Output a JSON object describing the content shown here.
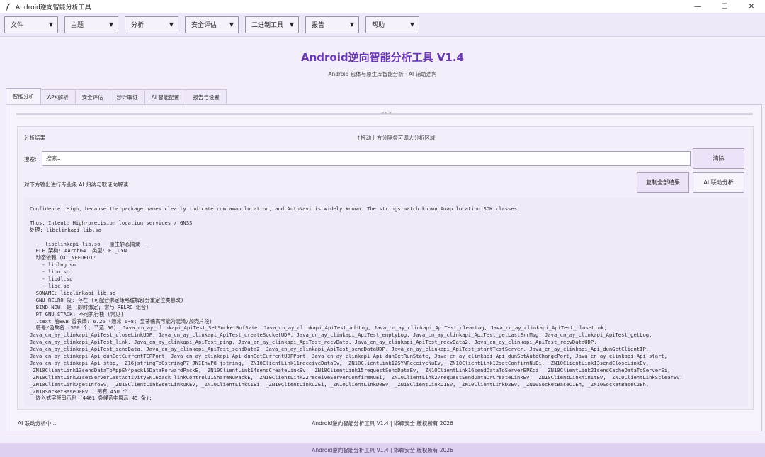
{
  "window": {
    "title": "Android逆向智能分析工具",
    "icon": "feather-icon",
    "controls": {
      "minimize": "—",
      "maximize": "☐",
      "close": "✕"
    }
  },
  "toolbar": {
    "menus": [
      {
        "label": "文件"
      },
      {
        "label": "主题"
      },
      {
        "label": "分析"
      },
      {
        "label": "安全评估"
      },
      {
        "label": "二进制工具"
      },
      {
        "label": "报告"
      },
      {
        "label": "帮助"
      }
    ],
    "caret": "▼"
  },
  "header": {
    "title": "Android逆向智能分析工具 V1.4",
    "subtitle": "Android 包体与原生库智能分析 · AI 辅助逆向"
  },
  "tabs": [
    {
      "label": "智能分析",
      "active": true
    },
    {
      "label": "APK解析"
    },
    {
      "label": "安全评估"
    },
    {
      "label": "涉诈取证"
    },
    {
      "label": "AI 智能配置"
    },
    {
      "label": "报告与设置"
    }
  ],
  "panel": {
    "splitter_grip": "⠿⠿⠿",
    "result_label": "分析结果",
    "drag_hint": "↑拖动上方分隔条可调大分析区域",
    "search": {
      "label": "搜索:",
      "placeholder": "搜索..."
    },
    "clear_button": "清除",
    "ai_hint": "对下方输出进行专业级 AI 归纳与取证向解读",
    "copy_button": "复制全部结果",
    "ai_button": "AI 联动分析",
    "output_lines": [
      "Confidence: High, because the package names clearly indicate com.amap.location, and AutoNavi is widely known. The strings match known Amap location SDK classes.",
      "",
      "Thus, Intent: High-precision location services / GNSS",
      "处理: libclinkapi-lib.so",
      "",
      "  ── libclinkapi-lib.so · 原生静态摘录 ──",
      "  ELF 架构: AArch64  类型: ET_DYN",
      "  动态依赖 (DT_NEEDED):",
      "    - liblog.so",
      "    - libm.so",
      "    - libdl.so",
      "    - libc.so",
      "  SONAME: libclinkapi-lib.so",
      "  GNU RELRO 段: 存在 (可配合绑定策略缓解部分重定位类篡改)",
      "  BIND_NOW: 是 (即时绑定; 常与 RELRO 组合)",
      "  PT_GNU_STACK: 不可执行栈 (常见)",
      "  .text 前8KB 香农熵: 6.26 (通常 6~8; 显著偏高可能为混淆/加壳片段)",
      "  符号/函数名 (500 个, 节选 50): Java_cn_ay_clinkapi_ApiTest_SetSocketBufSzie, Java_cn_ay_clinkapi_ApiTest_addLog, Java_cn_ay_clinkapi_ApiTest_clearLog, Java_cn_ay_clinkapi_ApiTest_closeLink,",
      "Java_cn_ay_clinkapi_ApiTest_closeLinkUDP, Java_cn_ay_clinkapi_ApiTest_createSocketUDP, Java_cn_ay_clinkapi_ApiTest_emptyLog, Java_cn_ay_clinkapi_ApiTest_getLastErrMsg, Java_cn_ay_clinkapi_ApiTest_getLog,",
      "Java_cn_ay_clinkapi_ApiTest_link, Java_cn_ay_clinkapi_ApiTest_ping, Java_cn_ay_clinkapi_ApiTest_recvData, Java_cn_ay_clinkapi_ApiTest_recvData2, Java_cn_ay_clinkapi_ApiTest_recvDataUDP,",
      "Java_cn_ay_clinkapi_ApiTest_sendData, Java_cn_ay_clinkapi_ApiTest_sendData2, Java_cn_ay_clinkapi_ApiTest_sendDataUDP, Java_cn_ay_clinkapi_ApiTest_startTestServer, Java_cn_ay_clinkapi_Api_dunGetClientIP,",
      "Java_cn_ay_clinkapi_Api_dunGetCurrentTCPPort, Java_cn_ay_clinkapi_Api_dunGetCurrentUDPPort, Java_cn_ay_clinkapi_Api_dunGetRunState, Java_cn_ay_clinkapi_Api_dunSetAutoChangePort, Java_cn_ay_clinkapi_Api_start,",
      "Java_cn_ay_clinkapi_Api_stop, _Z16jstringToCstringP7_JNIEnvP8_jstring, _ZN10ClientLink11receiveDataEv, _ZN10ClientLink12SYNReceiveNuEv, _ZN10ClientLink12setConfirmNuEi, _ZN10ClientLink13sendCloseLinkEv,",
      "_ZN10ClientLink13sendDataToAppEN4pack15DataForwardPackE, _ZN10ClientLink14sendCreateLinkEv, _ZN10ClientLink15requestSendDataEv, _ZN10ClientLink16sendDataToServerEPKci, _ZN10ClientLink21sendCacheDataToServerEi,",
      "_ZN10ClientLink21setServerLastActivityEN16pack_linkControl11ShareNuPackE, _ZN10ClientLink22receiveServerConfirmNuEi, _ZN10ClientLink27requestSendDataOrCreateLinkEv, _ZN10ClientLink4inItEv, _ZN10ClientLinkSclearEv,",
      "_ZN10ClientLink7getInfoEv, _ZN10ClientLink9setLinkOKEv, _ZN10ClientLinkC1Ei, _ZN10ClientLinkC2Ei, _ZN10ClientLinkD0Ev, _ZN10ClientLinkD1Ev, _ZN10ClientLinkD2Ev, _ZN10SocketBaseC1Eh, _ZN10SocketBaseC2Eh,",
      "_ZN10SocketBaseD0Ev … 另有 450 个",
      "  嵌入式字符串示例 (4401 条候选中展示 45 条):"
    ]
  },
  "status": {
    "left": "AI 联动分析中...",
    "center": "Android逆向智能分析工具 V1.4 | 邯郸安全 版权所有 2026"
  },
  "footer": {
    "text": "Android逆向智能分析工具 V1.4 | 邯郸安全 版权所有 2026"
  },
  "colors": {
    "accent": "#6a3ab0",
    "background": "#f4eefb",
    "footer": "#ddd0f0"
  }
}
